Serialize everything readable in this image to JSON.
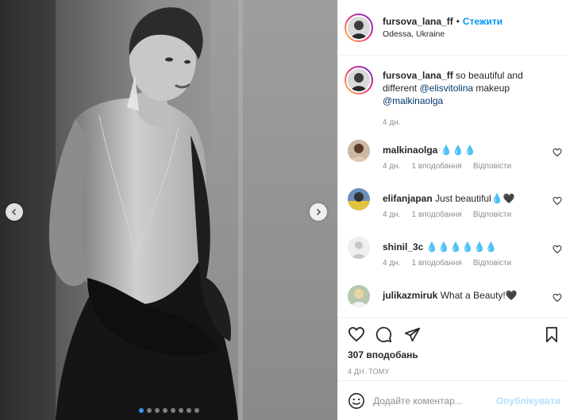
{
  "post": {
    "author": "fursova_lana_ff",
    "follow_label": "Стежити",
    "separator": "•",
    "location": "Odessa, Ukraine",
    "carousel_dots": 8,
    "active_dot": 0
  },
  "caption": {
    "username": "fursova_lana_ff",
    "text_before": "so beautiful and different",
    "mention1": "@elisvitolina",
    "text_middle": "makeup",
    "mention2": "@malkinaolga",
    "time": "4 дн."
  },
  "comments": [
    {
      "username": "malkinaolga",
      "text": "💧💧💧",
      "time": "4 дн.",
      "likes": "1 вподобання",
      "reply": "Відповісти"
    },
    {
      "username": "elifanjapan",
      "text": "Just beautiful💧🖤",
      "time": "4 дн.",
      "likes": "1 вподобання",
      "reply": "Відповісти"
    },
    {
      "username": "shinil_3c",
      "text": "💧💧💧💧💧💧",
      "time": "4 дн.",
      "likes": "1 вподобання",
      "reply": "Відповісти"
    },
    {
      "username": "julikazmiruk",
      "text": "What a Beauty!🖤",
      "time": "",
      "likes": "",
      "reply": ""
    }
  ],
  "likes_count": "307 вподобань",
  "posted_ago": "4 ДН. ТОМУ",
  "comment_box": {
    "placeholder": "Додайте коментар...",
    "publish_label": "Опублікувати"
  },
  "colors": {
    "link": "#0095f6",
    "mention": "#00376b",
    "muted": "#8e8e8e",
    "publish_disabled": "#b2dffc",
    "active_dot": "#3897f0"
  },
  "icons": {
    "like": "heart-icon",
    "comment": "comment-icon",
    "share": "share-icon",
    "save": "bookmark-icon",
    "prev": "chevron-left-icon",
    "next": "chevron-right-icon",
    "emoji": "emoji-icon"
  }
}
